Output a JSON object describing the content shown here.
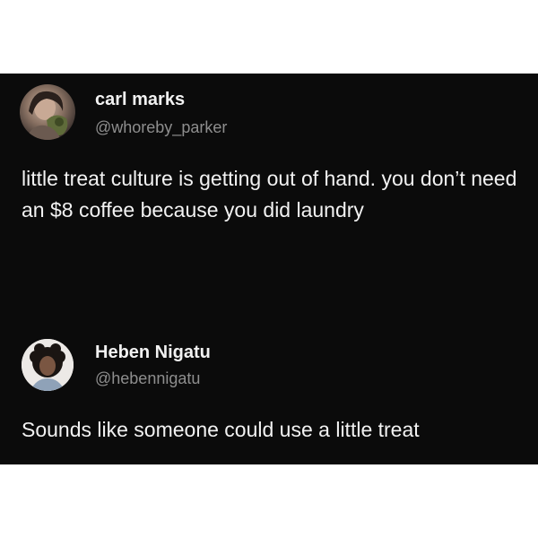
{
  "tweets": [
    {
      "display_name": "carl marks",
      "handle": "@whoreby_parker",
      "text": "little treat culture is getting out of hand. you don’t need an $8 coffee because you did laundry",
      "avatar_icon": "user-avatar-photo"
    },
    {
      "display_name": "Heben Nigatu",
      "handle": "@hebennigatu",
      "text": "Sounds like someone could use a little treat",
      "avatar_icon": "user-avatar-photo"
    }
  ],
  "colors": {
    "background": "#0b0b0b",
    "page_background": "#ffffff",
    "primary_text": "#f2f2f2",
    "secondary_text": "#8e8e8e"
  }
}
